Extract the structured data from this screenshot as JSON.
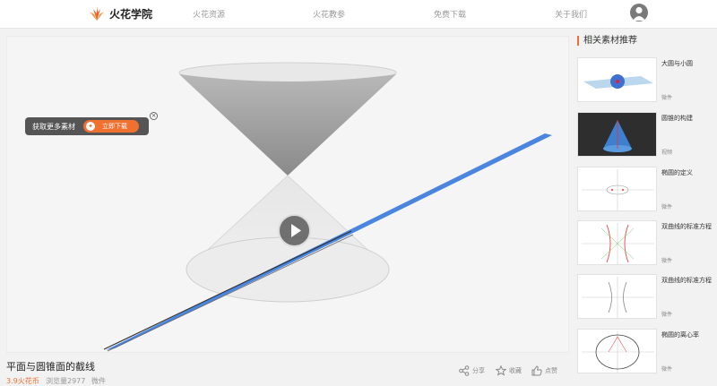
{
  "header": {
    "logo_text": "火花学院",
    "nav": [
      "火花资源",
      "火花教参",
      "免费下载",
      "关于我们"
    ]
  },
  "player": {
    "overlay_text": "获取更多素材",
    "download_label": "立即下载"
  },
  "info": {
    "title": "平面与圆锥面的截线",
    "price": "3.9火花币",
    "views": "浏览量2977",
    "type": "微件",
    "actions": {
      "share": "分享",
      "favorite": "收藏",
      "like": "点赞"
    }
  },
  "sidebar": {
    "title": "相关素材推荐",
    "cards": [
      {
        "name": "大圆与小圆",
        "type": "微件"
      },
      {
        "name": "圆锥的构建",
        "type": "视频"
      },
      {
        "name": "椭圆的定义",
        "type": "微件"
      },
      {
        "name": "双曲线的标准方程",
        "type": "微件"
      },
      {
        "name": "双曲线的标准方程",
        "type": "微件"
      },
      {
        "name": "椭圆的离心率",
        "type": "微件"
      }
    ]
  },
  "colors": {
    "accent": "#f07030",
    "plane": "#4a86e0"
  }
}
